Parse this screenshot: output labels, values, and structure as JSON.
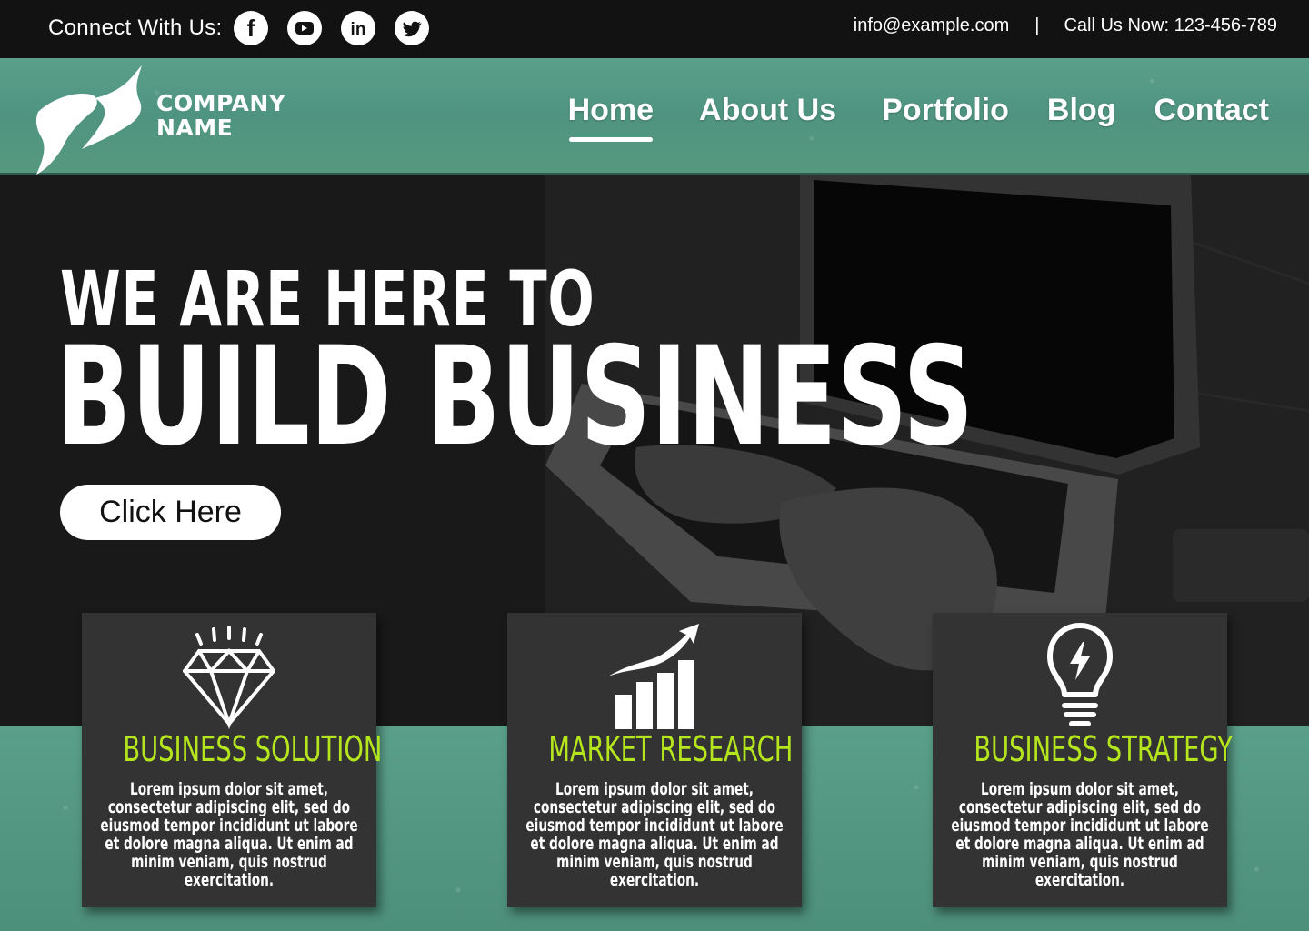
{
  "topbar": {
    "connect_label": "Connect With Us:",
    "social": [
      {
        "icon": "facebook-icon",
        "glyph": "f"
      },
      {
        "icon": "youtube-icon"
      },
      {
        "icon": "linkedin-icon",
        "glyph": "in"
      },
      {
        "icon": "twitter-icon"
      }
    ],
    "email": "info@example.com",
    "separator": "|",
    "phone": "Call Us Now: 123-456-789"
  },
  "header": {
    "logo_icon": "company-logo-icon",
    "company_line1": "COMPANY",
    "company_line2": "NAME",
    "nav": [
      {
        "label": "Home",
        "active": true
      },
      {
        "label": "About Us",
        "active": false
      },
      {
        "label": "Portfolio",
        "active": false
      },
      {
        "label": "Blog",
        "active": false
      },
      {
        "label": "Contact",
        "active": false
      }
    ]
  },
  "hero": {
    "line1": "WE ARE HERE TO",
    "line2": "BUILD BUSINESS",
    "cta_label": "Click Here",
    "background": "laptop-typing-photo"
  },
  "cards": [
    {
      "icon": "diamond-icon",
      "title": "BUSINESS SOLUTION",
      "text": "Lorem ipsum dolor sit amet, consectetur adipiscing elit, sed do eiusmod tempor incididunt ut labore et dolore magna aliqua. Ut enim ad minim veniam, quis nostrud exercitation."
    },
    {
      "icon": "growth-chart-icon",
      "title": "MARKET RESEARCH",
      "text": "Lorem ipsum dolor sit amet, consectetur adipiscing elit, sed do eiusmod tempor incididunt ut labore et dolore magna aliqua. Ut enim ad minim veniam, quis nostrud exercitation."
    },
    {
      "icon": "lightbulb-icon",
      "title": "BUSINESS STRATEGY",
      "text": "Lorem ipsum dolor sit amet, consectetur adipiscing elit, sed do eiusmod tempor incididunt ut labore et dolore magna aliqua. Ut enim ad minim veniam, quis nostrud exercitation."
    }
  ],
  "colors": {
    "topbar_bg": "#121212",
    "green": "#55997f",
    "card_bg": "#333333",
    "accent": "#b5e61d"
  }
}
